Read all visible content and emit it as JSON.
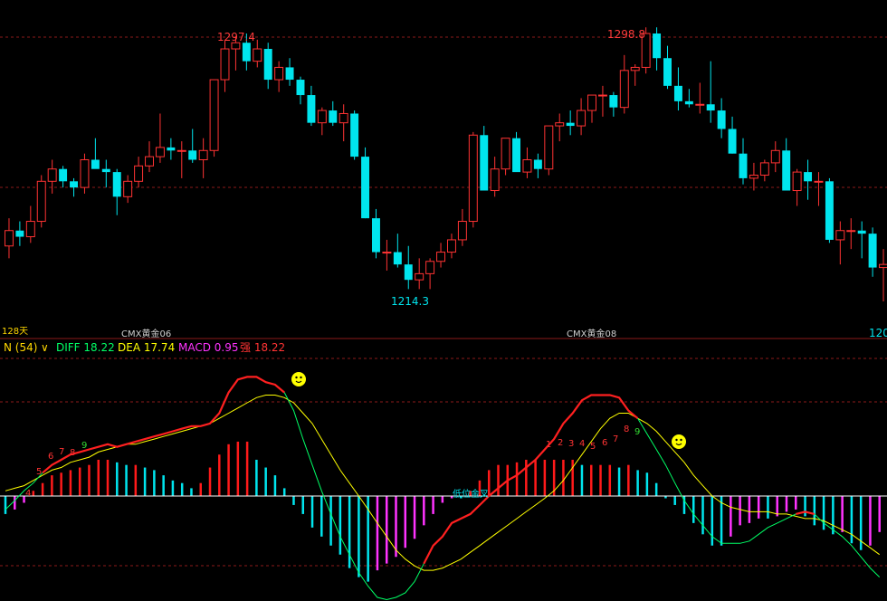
{
  "colors": {
    "up": "#ff3333",
    "down": "#00e5ee",
    "grid": "#8b1a1a",
    "diff": "#00ff66",
    "dea": "#ffff00",
    "macd_pos": "#ff1a1a",
    "macd_neg": "#00e5ee",
    "macd_mag": "#ff33ff",
    "zero": "#ffffff",
    "red_line": "#ff2020"
  },
  "price_panel": {
    "period_label": "128天",
    "contract_labels": [
      "CMX黄金06",
      "CMX黄金08"
    ],
    "high_labels": [
      "1297.4",
      "1298.8"
    ],
    "low_label": "1214.3",
    "right_edge_label": "120"
  },
  "indicator_panel": {
    "name": "N (54)",
    "dropdown_glyph": "∨",
    "diff_label": "DIFF 18.22",
    "dea_label": "DEA 17.74",
    "macd_label": "MACD 0.95",
    "strong_label": "强 18.22",
    "cross_label": "低位金叉",
    "count_labels_a": [
      "4",
      "5",
      "6",
      "7",
      "8",
      "9"
    ],
    "count_labels_b": [
      "1",
      "2",
      "3",
      "4",
      "5",
      "6",
      "7",
      "8",
      "9"
    ]
  },
  "chart_data": [
    {
      "type": "candlestick",
      "ylim": [
        1205,
        1302
      ],
      "candles": [
        [
          1228,
          1237,
          1224,
          1233
        ],
        [
          1233,
          1236,
          1228,
          1231
        ],
        [
          1231,
          1241,
          1229,
          1236
        ],
        [
          1236,
          1251,
          1234,
          1249
        ],
        [
          1249,
          1256,
          1245,
          1253
        ],
        [
          1253,
          1254,
          1247,
          1249
        ],
        [
          1249,
          1250,
          1244,
          1247
        ],
        [
          1247,
          1258,
          1245,
          1256
        ],
        [
          1256,
          1263,
          1254,
          1253
        ],
        [
          1253,
          1256,
          1247,
          1252
        ],
        [
          1252,
          1253,
          1238,
          1244
        ],
        [
          1244,
          1251,
          1242,
          1249
        ],
        [
          1249,
          1257,
          1247,
          1254
        ],
        [
          1254,
          1262,
          1252,
          1257
        ],
        [
          1257,
          1271,
          1255,
          1260
        ],
        [
          1260,
          1263,
          1256,
          1259
        ],
        [
          1259,
          1262,
          1250,
          1259
        ],
        [
          1259,
          1266,
          1255,
          1256
        ],
        [
          1256,
          1263,
          1250,
          1259
        ],
        [
          1259,
          1281,
          1257,
          1282
        ],
        [
          1282,
          1295,
          1278,
          1292
        ],
        [
          1292,
          1296,
          1285,
          1294
        ],
        [
          1294,
          1297,
          1285,
          1288
        ],
        [
          1288,
          1295,
          1286,
          1292
        ],
        [
          1292,
          1294,
          1279,
          1282
        ],
        [
          1282,
          1288,
          1278,
          1286
        ],
        [
          1286,
          1289,
          1280,
          1282
        ],
        [
          1282,
          1283,
          1274,
          1277
        ],
        [
          1277,
          1280,
          1267,
          1268
        ],
        [
          1268,
          1273,
          1264,
          1272
        ],
        [
          1272,
          1275,
          1267,
          1268
        ],
        [
          1268,
          1274,
          1262,
          1271
        ],
        [
          1271,
          1272,
          1256,
          1257
        ],
        [
          1257,
          1260,
          1237,
          1237
        ],
        [
          1237,
          1240,
          1224,
          1226
        ],
        [
          1226,
          1230,
          1220,
          1226
        ],
        [
          1226,
          1232,
          1221,
          1222
        ],
        [
          1222,
          1228,
          1214,
          1217
        ],
        [
          1217,
          1224,
          1214,
          1219
        ],
        [
          1219,
          1224,
          1214,
          1223
        ],
        [
          1223,
          1229,
          1221,
          1226
        ],
        [
          1226,
          1232,
          1224,
          1230
        ],
        [
          1230,
          1240,
          1228,
          1236
        ],
        [
          1236,
          1265,
          1234,
          1264
        ],
        [
          1264,
          1267,
          1246,
          1246
        ],
        [
          1246,
          1257,
          1244,
          1253
        ],
        [
          1253,
          1263,
          1251,
          1263
        ],
        [
          1263,
          1265,
          1253,
          1252
        ],
        [
          1252,
          1260,
          1250,
          1256
        ],
        [
          1256,
          1258,
          1250,
          1253
        ],
        [
          1253,
          1262,
          1251,
          1267
        ],
        [
          1267,
          1271,
          1262,
          1268
        ],
        [
          1268,
          1272,
          1264,
          1267
        ],
        [
          1267,
          1276,
          1264,
          1272
        ],
        [
          1272,
          1277,
          1268,
          1277
        ],
        [
          1277,
          1280,
          1270,
          1277
        ],
        [
          1277,
          1278,
          1270,
          1273
        ],
        [
          1273,
          1290,
          1271,
          1285
        ],
        [
          1285,
          1287,
          1280,
          1286
        ],
        [
          1286,
          1299,
          1284,
          1297
        ],
        [
          1297,
          1299,
          1285,
          1289
        ],
        [
          1289,
          1293,
          1279,
          1280
        ],
        [
          1280,
          1286,
          1272,
          1275
        ],
        [
          1275,
          1279,
          1273,
          1274
        ],
        [
          1274,
          1281,
          1271,
          1274
        ],
        [
          1274,
          1288,
          1268,
          1272
        ],
        [
          1272,
          1276,
          1263,
          1266
        ],
        [
          1266,
          1270,
          1258,
          1258
        ],
        [
          1258,
          1263,
          1248,
          1250
        ],
        [
          1250,
          1255,
          1246,
          1251
        ],
        [
          1251,
          1256,
          1249,
          1255
        ],
        [
          1255,
          1262,
          1252,
          1259
        ],
        [
          1259,
          1263,
          1246,
          1246
        ],
        [
          1246,
          1253,
          1241,
          1252
        ],
        [
          1252,
          1256,
          1243,
          1249
        ],
        [
          1249,
          1252,
          1241,
          1249
        ],
        [
          1249,
          1250,
          1229,
          1230
        ],
        [
          1230,
          1236,
          1222,
          1233
        ],
        [
          1233,
          1237,
          1227,
          1233
        ],
        [
          1233,
          1236,
          1224,
          1232
        ],
        [
          1232,
          1234,
          1218,
          1221
        ],
        [
          1221,
          1227,
          1210,
          1222
        ]
      ]
    },
    {
      "type": "bar",
      "series": [
        {
          "name": "MACD",
          "values": [
            -8,
            -6,
            -3,
            2,
            5,
            8,
            9,
            10,
            11,
            12,
            14,
            14,
            13,
            12,
            12,
            11,
            10,
            8,
            6,
            5,
            3,
            5,
            11,
            16,
            20,
            21,
            21,
            14,
            11,
            8,
            3,
            -4,
            -8,
            -14,
            -18,
            -22,
            -26,
            -32,
            -36,
            -38,
            -33,
            -30,
            -27,
            -23,
            -19,
            -13,
            -8,
            -3,
            -1,
            -1,
            2,
            6,
            10,
            12,
            12,
            13,
            14,
            14,
            14,
            14,
            14,
            14,
            12,
            12,
            12,
            12,
            11,
            12,
            10,
            9,
            5,
            -1,
            -4,
            -8,
            -12,
            -17,
            -22,
            -22,
            -18,
            -13,
            -12,
            -10,
            -10,
            -9,
            -7,
            -6,
            -9,
            -13,
            -15,
            -17,
            -16,
            -21,
            -24,
            -22,
            -16
          ]
        },
        {
          "name": "DIFF",
          "values": [
            -6,
            -2,
            2,
            5,
            9,
            12,
            14,
            16,
            17,
            18,
            19,
            20,
            19,
            20,
            21,
            22,
            23,
            24,
            25,
            26,
            27,
            27,
            28,
            32,
            40,
            45,
            46,
            46,
            44,
            43,
            40,
            33,
            22,
            12,
            2,
            -8,
            -18,
            -26,
            -34,
            -40,
            -45,
            -46,
            -45,
            -43,
            -38,
            -30,
            -22,
            -18,
            -12,
            -10,
            -8,
            -4,
            0,
            3,
            6,
            8,
            11,
            14,
            18,
            22,
            28,
            32,
            37,
            39,
            39,
            39,
            38,
            33,
            30,
            24,
            18,
            12,
            5,
            -2,
            -8,
            -13,
            -18,
            -21,
            -21,
            -21,
            -20,
            -17,
            -14,
            -12,
            -10,
            -8,
            -7,
            -8,
            -12,
            -15,
            -18,
            -22,
            -27,
            -32,
            -36
          ]
        },
        {
          "name": "DEA",
          "values": [
            2,
            3,
            4,
            6,
            8,
            10,
            11,
            13,
            14,
            15,
            17,
            18,
            19,
            20,
            20,
            21,
            22,
            23,
            24,
            25,
            26,
            27,
            28,
            30,
            32,
            34,
            36,
            38,
            39,
            39,
            38,
            36,
            32,
            28,
            22,
            16,
            10,
            5,
            0,
            -6,
            -12,
            -18,
            -24,
            -28,
            -31,
            -33,
            -33,
            -32,
            -30,
            -28,
            -25,
            -22,
            -19,
            -16,
            -13,
            -10,
            -7,
            -4,
            -1,
            2,
            6,
            11,
            16,
            21,
            26,
            30,
            32,
            32,
            30,
            28,
            25,
            21,
            17,
            13,
            8,
            4,
            0,
            -3,
            -5,
            -6,
            -7,
            -7,
            -7,
            -8,
            -8,
            -9,
            -10,
            -10,
            -11,
            -13,
            -15,
            -17,
            -20,
            -23,
            -26
          ]
        }
      ],
      "ylim": [
        -45,
        50
      ]
    }
  ]
}
